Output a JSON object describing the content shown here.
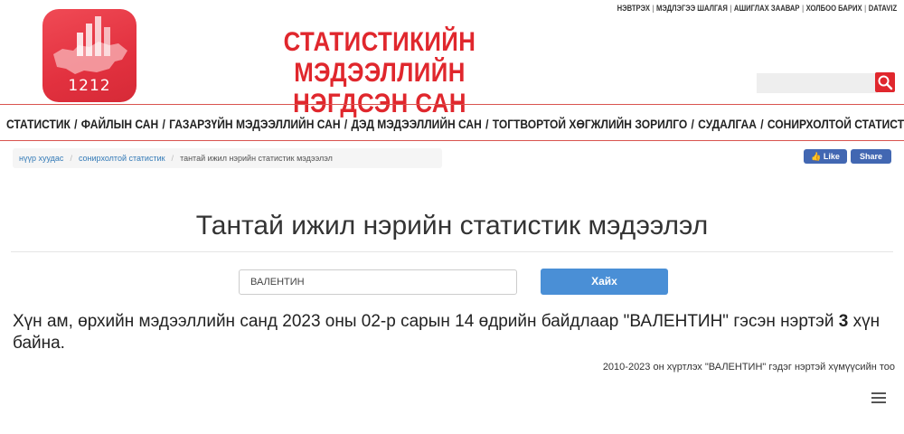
{
  "logo": {
    "number": "1212"
  },
  "site_title": {
    "line1": "СТАТИСТИКИЙН МЭДЭЭЛЛИЙН",
    "line2": "НЭГДСЭН САН"
  },
  "top_links": [
    "НЭВТРЭХ",
    "МЭДЛЭГЭЭ ШАЛГАЯ",
    "АШИГЛАХ ЗААВАР",
    "ХОЛБОО БАРИХ",
    "DATAVIZ"
  ],
  "nav": [
    "СТАТИСТИК",
    "ФАЙЛЫН САН",
    "ГАЗАРЗҮЙН МЭДЭЭЛЛИЙН САН",
    "ДЭД МЭДЭЭЛЛИЙН САН",
    "ТОГТВОРТОЙ ХӨГЖЛИЙН ЗОРИЛГО",
    "СУДАЛГАА",
    "СОНИРХОЛТОЙ СТАТИСТИК"
  ],
  "breadcrumb": [
    "нүүр хуудас",
    "сонирхолтой статистик",
    "тантай ижил нэрийн статистик мэдээлэл"
  ],
  "social": {
    "like": "Like",
    "share": "Share"
  },
  "page_title": "Тантай ижил нэрийн статистик мэдээлэл",
  "search": {
    "value": "ВАЛЕНТИН",
    "button": "Хайх"
  },
  "result": {
    "prefix": "Хүн ам, өрхийн мэдээллийн санд 2023 оны 02-р сарын 14 өдрийн байдлаар \"ВАЛЕНТИН\" гэсэн нэртэй ",
    "count": "3",
    "suffix": " хүн байна."
  },
  "chart_caption": "2010-2023 он хүртлэх \"ВАЛЕНТИН\" гэдэг нэртэй хүмүүсийн тоо",
  "colors": {
    "brand_red": "#e0272d",
    "button_blue": "#4a8fd6",
    "facebook": "#4267b2"
  }
}
